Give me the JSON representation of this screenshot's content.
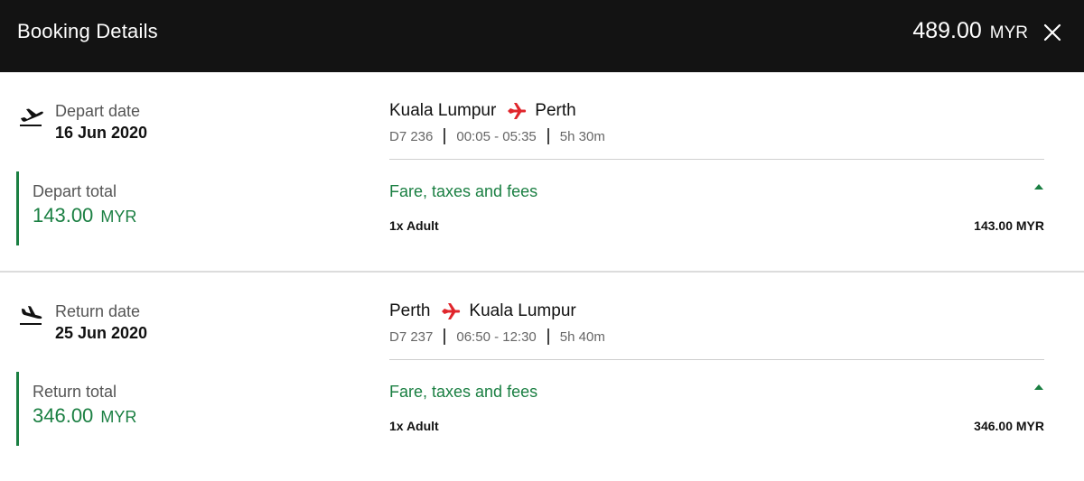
{
  "header": {
    "title": "Booking Details",
    "total_amount": "489.00",
    "total_currency": "MYR"
  },
  "icons": {
    "close": "close-icon",
    "depart": "plane-takeoff-icon",
    "return": "plane-landing-icon",
    "route": "plane-icon"
  },
  "colors": {
    "header_bg": "#131313",
    "accent_green": "#1a7f42",
    "plane_red": "#e0262c"
  },
  "depart": {
    "date_label": "Depart date",
    "date": "16 Jun 2020",
    "total_label": "Depart total",
    "total_amount": "143.00",
    "total_currency": "MYR",
    "origin": "Kuala Lumpur",
    "destination": "Perth",
    "flight_number": "D7 236",
    "time": "00:05 - 05:35",
    "duration": "5h 30m",
    "fare_title": "Fare, taxes and fees",
    "passenger": "1x Adult",
    "passenger_price": "143.00 MYR"
  },
  "return": {
    "date_label": "Return date",
    "date": "25 Jun 2020",
    "total_label": "Return total",
    "total_amount": "346.00",
    "total_currency": "MYR",
    "origin": "Perth",
    "destination": "Kuala Lumpur",
    "flight_number": "D7 237",
    "time": "06:50 - 12:30",
    "duration": "5h 40m",
    "fare_title": "Fare, taxes and fees",
    "passenger": "1x Adult",
    "passenger_price": "346.00 MYR"
  }
}
